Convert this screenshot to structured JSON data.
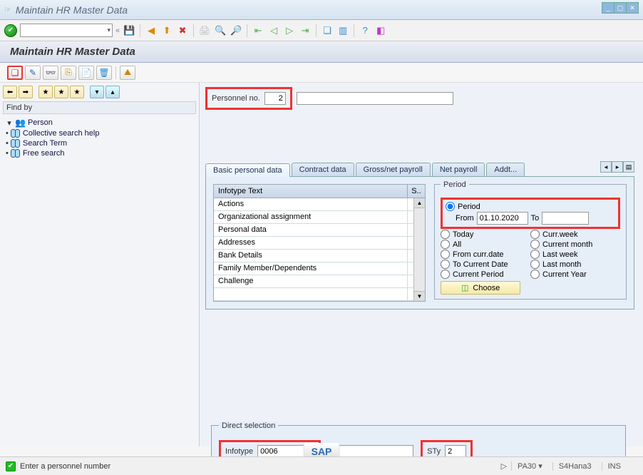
{
  "window": {
    "title": "Maintain HR Master Data"
  },
  "header": {
    "title": "Maintain HR Master Data"
  },
  "left": {
    "findby": "Find by",
    "tree": {
      "root": "Person",
      "children": [
        "Collective search help",
        "Search Term",
        "Free search"
      ]
    }
  },
  "pers": {
    "label": "Personnel no.",
    "value": "2"
  },
  "tabs": [
    "Basic personal data",
    "Contract data",
    "Gross/net payroll",
    "Net payroll",
    "Addt..."
  ],
  "infotype_table": {
    "col1": "Infotype Text",
    "col2": "S..",
    "rows": [
      "Actions",
      "Organizational assignment",
      "Personal data",
      "Addresses",
      "Bank Details",
      "Family Member/Dependents",
      "Challenge"
    ]
  },
  "period": {
    "title": "Period",
    "radios": {
      "period": "Period",
      "from": "From",
      "to": "To",
      "from_value": "01.10.2020",
      "today": "Today",
      "currweek": "Curr.week",
      "all": "All",
      "currmonth": "Current month",
      "fromcurr": "From curr.date",
      "lastweek": "Last week",
      "tocurr": "To Current Date",
      "lastmonth": "Last month",
      "currperiod": "Current Period",
      "curryear": "Current Year"
    },
    "choose": "Choose"
  },
  "direct": {
    "title": "Direct selection",
    "infotype_label": "Infotype",
    "infotype_value": "0006",
    "sty_label": "STy",
    "sty_value": "2"
  },
  "status": {
    "msg": "Enter a personnel number",
    "tcode": "PA30",
    "sys": "S4Hana3",
    "mode": "INS"
  }
}
